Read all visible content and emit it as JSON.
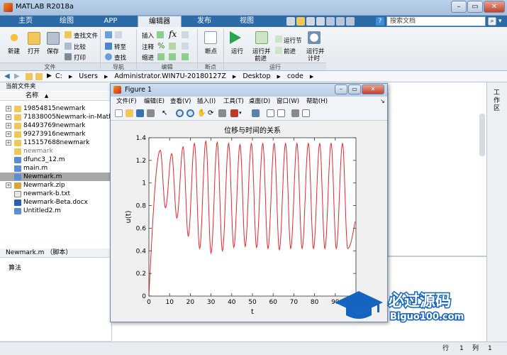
{
  "app": {
    "title": "MATLAB R2018a"
  },
  "tabs": [
    "主页",
    "绘图",
    "APP",
    "编辑器",
    "发布",
    "视图"
  ],
  "search": {
    "placeholder": "搜索文档"
  },
  "ribbon": {
    "new": "新建",
    "open": "打开",
    "save": "保存",
    "find_file": "查找文件",
    "compare": "比较",
    "print": "打印",
    "go_to": "转至",
    "find": "查找",
    "insert": "插入",
    "comment": "注释",
    "indent": "缩进",
    "breakpoint": "断点",
    "run": "运行",
    "run_and_advance": [
      "运行并",
      "前进"
    ],
    "run_section": "运行节",
    "advance": "前进",
    "run_and_time": [
      "运行并",
      "计时"
    ],
    "sections": {
      "file": "文件",
      "navigate": "导航",
      "edit": "编辑",
      "breakpoints": "断点",
      "run": "运行"
    }
  },
  "address": {
    "parts": [
      "C:",
      "Users",
      "Administrator.WIN7U-20180127Z",
      "Desktop",
      "code"
    ],
    "separator": "▶"
  },
  "left_panel": {
    "title": "当前文件夹",
    "column_name": "名称",
    "files": [
      {
        "name": "19854815newmark",
        "type": "folder",
        "expandable": true,
        "selected": false
      },
      {
        "name": "71838005Newmark-in-Matlab",
        "type": "folder",
        "expandable": true,
        "selected": false
      },
      {
        "name": "84493769newmark",
        "type": "folder",
        "expandable": true,
        "selected": false
      },
      {
        "name": "99273916newmark",
        "type": "folder",
        "expandable": true,
        "selected": false
      },
      {
        "name": "115157688newmark",
        "type": "folder",
        "expandable": true,
        "selected": false
      },
      {
        "name": "newmark",
        "type": "folder",
        "expandable": false,
        "selected": false
      },
      {
        "name": "dfunc3_12.m",
        "type": "mfile",
        "expandable": false,
        "selected": false
      },
      {
        "name": "main.m",
        "type": "mfile",
        "expandable": false,
        "selected": false
      },
      {
        "name": "Newmark.m",
        "type": "mfile",
        "expandable": false,
        "selected": true
      },
      {
        "name": "Newmark.zip",
        "type": "zip",
        "expandable": true,
        "selected": false
      },
      {
        "name": "newmark-b.txt",
        "type": "txt",
        "expandable": false,
        "selected": false
      },
      {
        "name": "Newmark-Beta.docx",
        "type": "docx",
        "expandable": false,
        "selected": false
      },
      {
        "name": "Untitled2.m",
        "type": "mfile",
        "expandable": false,
        "selected": false
      }
    ]
  },
  "detail_panel": {
    "title": "Newmark.m （脚本）",
    "content": "算法"
  },
  "right_panel": {
    "label": "工作区"
  },
  "status": {
    "row_label": "行",
    "row": "1",
    "col_label": "列",
    "col": "1"
  },
  "figure": {
    "title": "Figure 1",
    "menu": [
      "文件(F)",
      "编辑(E)",
      "查看(V)",
      "插入(I)",
      "工具(T)",
      "桌面(D)",
      "窗口(W)",
      "帮助(H)"
    ]
  },
  "chart_data": {
    "type": "line",
    "title": "位移与时间的关系",
    "xlabel": "t",
    "ylabel": "u(t)",
    "xlim": [
      0,
      100
    ],
    "ylim": [
      0,
      1.4
    ],
    "xticks": [
      0,
      10,
      20,
      30,
      40,
      50,
      60,
      70,
      80,
      90
    ],
    "yticks": [
      0,
      0.2,
      0.4,
      0.6,
      0.8,
      1,
      1.2,
      1.4
    ],
    "series_color": "#e8262b",
    "peaks": [
      {
        "t": 5.5,
        "u": 1.29
      },
      {
        "t": 11,
        "u": 1.26
      },
      {
        "t": 16.5,
        "u": 1.32
      },
      {
        "t": 22,
        "u": 1.35
      },
      {
        "t": 27.5,
        "u": 1.37
      },
      {
        "t": 33,
        "u": 1.36
      },
      {
        "t": 38.5,
        "u": 1.35
      },
      {
        "t": 44,
        "u": 1.34
      },
      {
        "t": 49.5,
        "u": 1.35
      },
      {
        "t": 55,
        "u": 1.35
      },
      {
        "t": 60.5,
        "u": 1.35
      },
      {
        "t": 66,
        "u": 1.35
      },
      {
        "t": 71.5,
        "u": 1.35
      },
      {
        "t": 77,
        "u": 1.35
      },
      {
        "t": 82.5,
        "u": 1.35
      },
      {
        "t": 88,
        "u": 1.35
      },
      {
        "t": 93.5,
        "u": 1.35
      }
    ],
    "troughs": [
      {
        "t": 8,
        "u": 0.78
      },
      {
        "t": 13.5,
        "u": 0.69
      },
      {
        "t": 19,
        "u": 0.53
      },
      {
        "t": 24.5,
        "u": 0.42
      },
      {
        "t": 30,
        "u": 0.38
      },
      {
        "t": 35.5,
        "u": 0.4
      },
      {
        "t": 41,
        "u": 0.43
      },
      {
        "t": 46.5,
        "u": 0.44
      },
      {
        "t": 52,
        "u": 0.43
      },
      {
        "t": 57.5,
        "u": 0.42
      },
      {
        "t": 63,
        "u": 0.41
      },
      {
        "t": 68.5,
        "u": 0.42
      },
      {
        "t": 74,
        "u": 0.42
      },
      {
        "t": 79.5,
        "u": 0.42
      },
      {
        "t": 85,
        "u": 0.42
      },
      {
        "t": 90.5,
        "u": 0.42
      },
      {
        "t": 96,
        "u": 0.42
      }
    ]
  },
  "watermark": {
    "line1": "必过源码",
    "line2": "Biguo100.com"
  }
}
